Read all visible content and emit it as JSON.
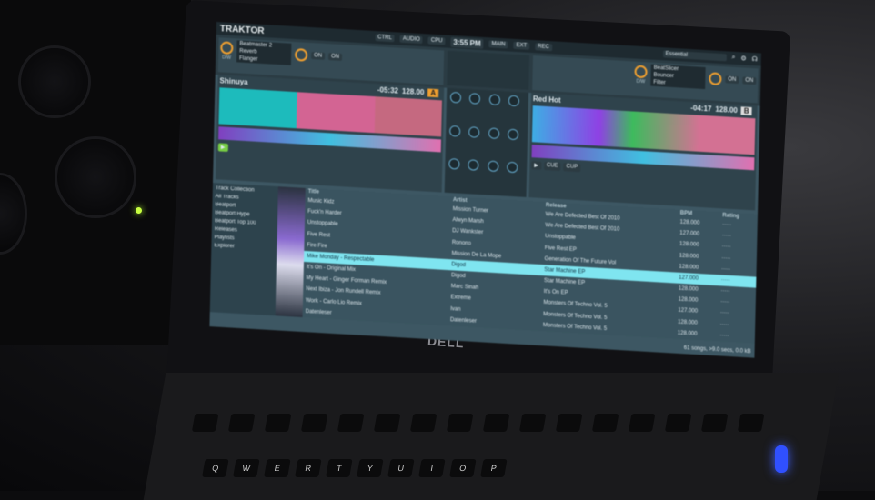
{
  "app": {
    "name": "TRAKTOR",
    "clock": "3:55 PM",
    "status": [
      "CTRL",
      "AUDIO",
      "CPU",
      "MAIN",
      "EXT",
      "REC"
    ],
    "layout": "Essential"
  },
  "fx_left": {
    "effects": [
      "Beatmaster 2",
      "Reverb",
      "Flanger"
    ],
    "labels": [
      "D/W",
      "ON",
      "ON"
    ]
  },
  "fx_right": {
    "effects": [
      "BeatSlicer",
      "Bouncer",
      "Filter"
    ],
    "labels": [
      "D/W",
      "ON",
      "ON"
    ]
  },
  "deck_a": {
    "title": "Shinuya",
    "time": "-05:32",
    "bpm": "128.00",
    "letter": "A"
  },
  "deck_b": {
    "title": "Red Hot",
    "time": "-04:17",
    "bpm": "128.00",
    "letter": "B",
    "buttons": [
      "CUE",
      "CUP"
    ]
  },
  "browser": {
    "tree": [
      "Track Collection",
      "All Tracks",
      "Beatport",
      "Beatport Hype",
      "Beatport Top 100",
      "Releases",
      "Playlists",
      "Explorer"
    ],
    "columns": [
      "Title",
      "Artist",
      "Release",
      "BPM",
      "Rating"
    ],
    "rows": [
      [
        "Music Kidz",
        "Mission Turner",
        "We Are Defected Best Of 2010",
        "128.000"
      ],
      [
        "Fuck'n Harder",
        "Alwyn Marsh",
        "We Are Defected Best Of 2010",
        "127.000"
      ],
      [
        "Unstoppable",
        "DJ Wankster",
        "Unstoppable",
        "128.000"
      ],
      [
        "Five Rest",
        "Ronono",
        "Five Rest EP",
        "128.000"
      ],
      [
        "Fire Fire",
        "Mission De La Mope",
        "Generation Of The Future Vol",
        "128.000"
      ],
      [
        "Mike Monday - Respectable",
        "Digod",
        "Star Machine EP",
        "127.000"
      ],
      [
        "It's On - Original Mix",
        "Digod",
        "Star Machine EP",
        "128.000"
      ],
      [
        "My Heart - Ginger Forman Remix",
        "Marc Sinah",
        "It's On EP",
        "128.000"
      ],
      [
        "Next Ibiza - Jon Rundell Remix",
        "Extreme",
        "Monsters Of Techno Vol. 5",
        "127.000"
      ],
      [
        "Work - Carlo Lio Remix",
        "Ivan",
        "Monsters Of Techno Vol. 5",
        "128.000"
      ],
      [
        "Datenleser",
        "Datenleser",
        "Monsters Of Techno Vol. 5",
        "128.000"
      ]
    ],
    "selected_row": 5,
    "footer": "61 songs, >9.0 secs, 0.0 kB"
  },
  "laptop": {
    "brand": "DELL"
  },
  "keys": [
    "Q",
    "W",
    "E",
    "R",
    "T",
    "Y",
    "U",
    "I",
    "O",
    "P"
  ]
}
